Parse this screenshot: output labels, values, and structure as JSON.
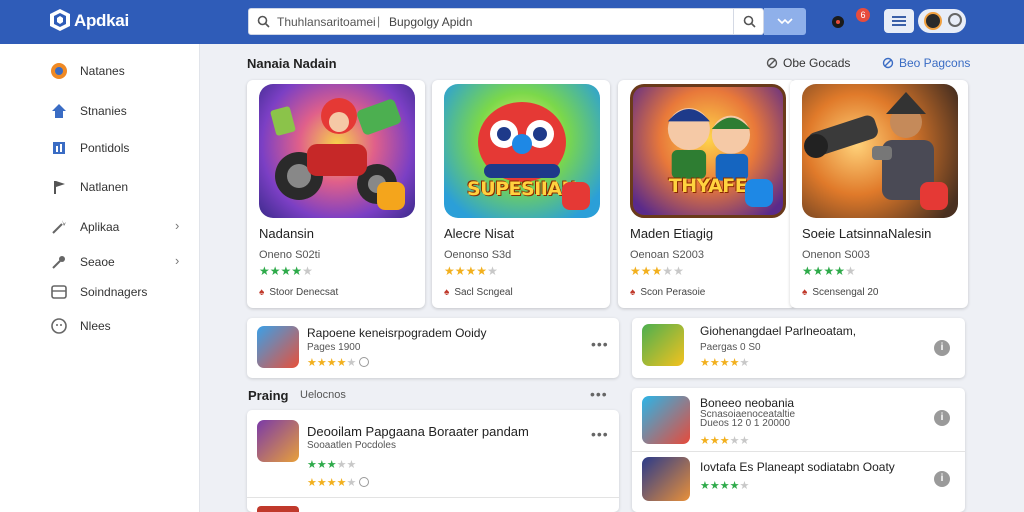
{
  "header": {
    "brand": "Apdkai",
    "search_placeholder": "Thuhlansaritoamei",
    "search_divider": "|",
    "search_value": "Bupgolgy Apidn",
    "notification_count": "6"
  },
  "sidebar": {
    "items": [
      {
        "label": "Natanes",
        "icon": "game-logo-icon"
      },
      {
        "label": "Stnanies",
        "icon": "home-icon"
      },
      {
        "label": "Pontidols",
        "icon": "chart-icon"
      },
      {
        "label": "Natlanen",
        "icon": "flag-icon"
      },
      {
        "label": "Aplikaa",
        "icon": "wand-icon",
        "chevron": "›"
      },
      {
        "label": "Seaoe",
        "icon": "pin-icon",
        "chevron": "›"
      },
      {
        "label": "Soindnagers",
        "icon": "grid-icon"
      },
      {
        "label": "Nlees",
        "icon": "face-icon"
      }
    ]
  },
  "main": {
    "featured_title": "Nanaia Nadain",
    "link_left": "Obe Gocads",
    "link_right": "Beo Pagcons",
    "cards": [
      {
        "art_text": "",
        "title": "Nadansin",
        "sub": "Oneno S02ti",
        "rating": 4,
        "star_color": "green",
        "meta": "Stoor Denecsat"
      },
      {
        "art_text": "SUPESIIAN",
        "title": "Alecre Nisat",
        "sub": "Oenonso S3d",
        "rating": 4,
        "star_color": "yellow",
        "meta": "Sacl Scngeal"
      },
      {
        "art_text": "THYAFE",
        "title": "Maden Etiagig",
        "sub": "Oenoan S2003",
        "rating": 3,
        "star_color": "yellow",
        "meta": "Scon Perasoie"
      },
      {
        "art_text": "",
        "title": "Soeie LatsinnaNalesin",
        "sub": "Onenon S003",
        "rating": 4,
        "star_color": "green",
        "meta": "Scensengal 20"
      }
    ],
    "section2_title": "Praing",
    "section2_sub": "Uelocnos",
    "list_left": [
      {
        "title": "Rapoene keneisrpogradem Ooidy",
        "sub": "Pages 1900",
        "rating": 4,
        "star_color": "yellow",
        "extra": ""
      },
      {
        "title": "Deooilam Papgaana Boraater pandam",
        "sub": "Sooaatlen Pocdoles",
        "rating": 3,
        "star_color": "green",
        "extra": "4"
      }
    ],
    "list_right": [
      {
        "title": "Giohenangdael Parlneoatam,",
        "sub": "Paergas 0 S0",
        "rating": 4,
        "star_color": "yellow"
      },
      {
        "title": "Boneeo neobania",
        "sub": "Scnasoiaenoceataltie",
        "sub2": "Dueos 12 0 1 20000",
        "rating": 3,
        "star_color": "yellow"
      },
      {
        "title": "Iovtafa Es Planeapt sodiatabn Ooaty",
        "sub": "",
        "rating": 4,
        "star_color": "green"
      }
    ],
    "list_left_partial": "",
    "more": "•••",
    "info": "i"
  },
  "colors": {
    "header": "#2f5cb8",
    "accent": "#3a6cc4",
    "star_yellow": "#f2b01e",
    "star_green": "#2eaa4a"
  }
}
